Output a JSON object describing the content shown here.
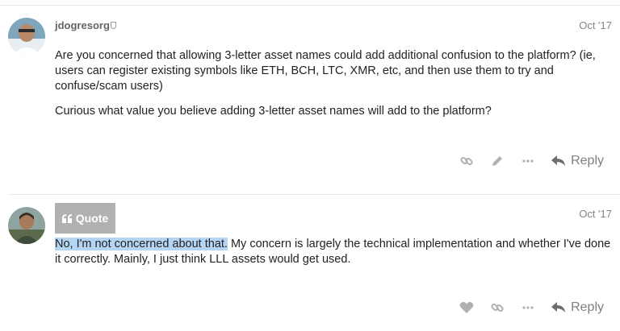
{
  "posts": [
    {
      "username": "jdogresorg",
      "date": "Oct '17",
      "paragraphs": [
        "Are you concerned that allowing 3-letter asset names could add additional confusion to the platform? (ie, users can register existing symbols like ETH, BCH, LTC, XMR, etc, and then use them to try and confuse/scam users)",
        "Curious what value you believe adding 3-letter asset names will add to the platform?"
      ],
      "actions": [
        "link-icon",
        "edit-icon",
        "more-icon"
      ],
      "reply_label": "Reply"
    },
    {
      "date": "Oct '17",
      "highlighted": "No, I'm not concerned about that.",
      "rest": " My concern is largely the technical implementation and whether I've done it correctly. Mainly, I just think LLL assets would get used.",
      "actions": [
        "heart-icon",
        "link-icon",
        "more-icon"
      ],
      "reply_label": "Reply"
    }
  ],
  "quote_popup": {
    "label": "Quote",
    "icon": "quote-icon"
  },
  "colors": {
    "highlight": "#b5d5f5",
    "quote_bg": "#b1b1b1",
    "muted": "#858585"
  }
}
